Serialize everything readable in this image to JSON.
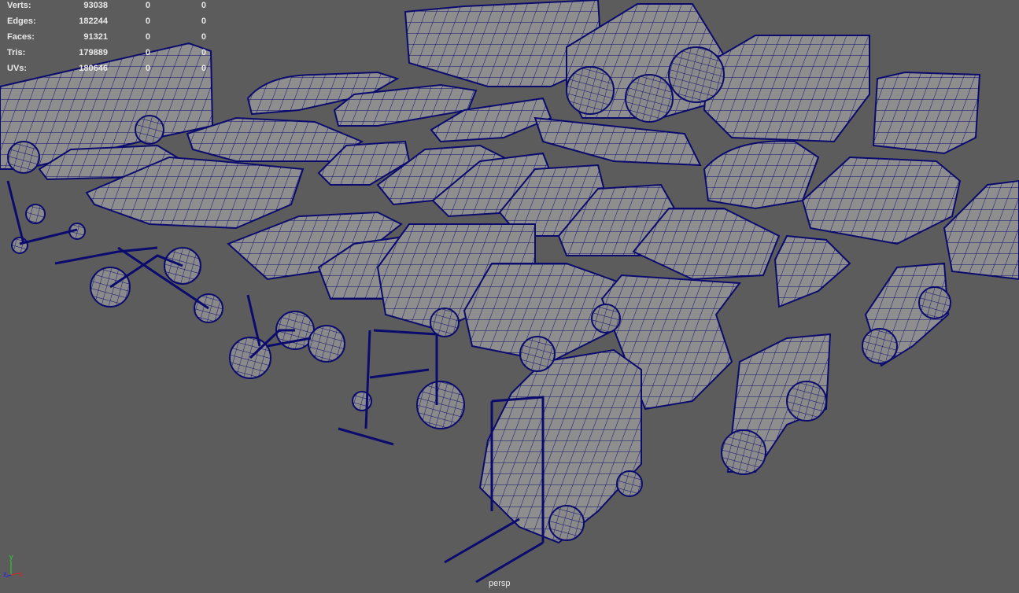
{
  "viewport": {
    "camera_label": "persp",
    "colors": {
      "background": "#5c5c5c",
      "wireframe": "#0b0b6e",
      "mesh_fill": "#8e8e8e",
      "hud_text": "#e8e8e8"
    }
  },
  "poly_count": [
    {
      "label": "Verts:",
      "values": [
        "93038",
        "0",
        "0"
      ]
    },
    {
      "label": "Edges:",
      "values": [
        "182244",
        "0",
        "0"
      ]
    },
    {
      "label": "Faces:",
      "values": [
        "91321",
        "0",
        "0"
      ]
    },
    {
      "label": "Tris:",
      "values": [
        "179889",
        "0",
        "0"
      ]
    },
    {
      "label": "UVs:",
      "values": [
        "180646",
        "0",
        "0"
      ]
    }
  ],
  "axis_gizmo": {
    "x": "x",
    "y": "y",
    "z": "z"
  }
}
